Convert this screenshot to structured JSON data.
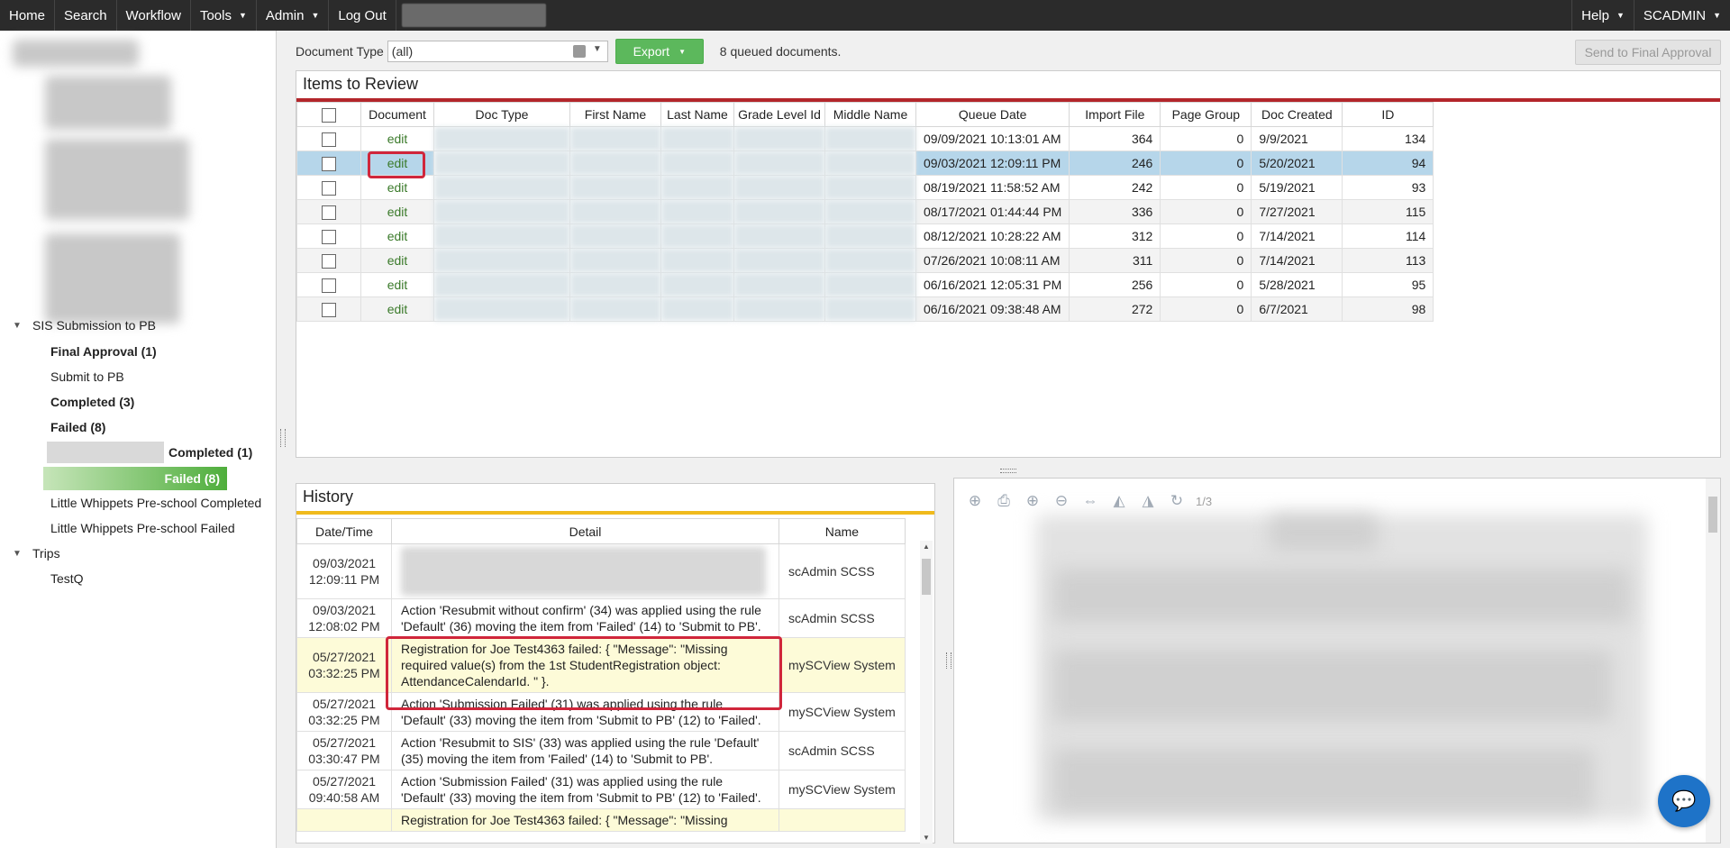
{
  "nav": {
    "items": [
      "Home",
      "Search",
      "Workflow",
      "Tools",
      "Admin",
      "Log Out"
    ],
    "help": "Help",
    "user": "SCADMIN"
  },
  "sidebar": {
    "group1": "SIS Submission to PB",
    "items": [
      "Final Approval (1)",
      "Submit to PB",
      "Completed (3)",
      "Failed (8)"
    ],
    "sub_completed": "Completed (1)",
    "sub_failed": "Failed (8)",
    "pre_completed": "Little Whippets Pre-school Completed",
    "pre_failed": "Little Whippets Pre-school Failed",
    "group2": "Trips",
    "trip_item": "TestQ"
  },
  "toolbar": {
    "doc_type_label": "Document Type",
    "doc_type_value": "(all)",
    "export_label": "Export",
    "queued_text": "8 queued documents.",
    "send_final_label": "Send to Final Approval"
  },
  "review": {
    "title": "Items to Review",
    "columns": [
      "Document",
      "Doc Type",
      "First Name",
      "Last Name",
      "Grade Level Id",
      "Middle Name",
      "Queue Date",
      "Import File",
      "Page Group",
      "Doc Created",
      "ID"
    ],
    "edit_label": "edit",
    "rows": [
      {
        "queue_date": "09/09/2021 10:13:01 AM",
        "import_file": "364",
        "page_group": "0",
        "doc_created": "9/9/2021",
        "id": "134"
      },
      {
        "queue_date": "09/03/2021 12:09:11 PM",
        "import_file": "246",
        "page_group": "0",
        "doc_created": "5/20/2021",
        "id": "94"
      },
      {
        "queue_date": "08/19/2021 11:58:52 AM",
        "import_file": "242",
        "page_group": "0",
        "doc_created": "5/19/2021",
        "id": "93"
      },
      {
        "queue_date": "08/17/2021 01:44:44 PM",
        "import_file": "336",
        "page_group": "0",
        "doc_created": "7/27/2021",
        "id": "115"
      },
      {
        "queue_date": "08/12/2021 10:28:22 AM",
        "import_file": "312",
        "page_group": "0",
        "doc_created": "7/14/2021",
        "id": "114"
      },
      {
        "queue_date": "07/26/2021 10:08:11 AM",
        "import_file": "311",
        "page_group": "0",
        "doc_created": "7/14/2021",
        "id": "113"
      },
      {
        "queue_date": "06/16/2021 12:05:31 PM",
        "import_file": "256",
        "page_group": "0",
        "doc_created": "5/28/2021",
        "id": "95"
      },
      {
        "queue_date": "06/16/2021 09:38:48 AM",
        "import_file": "272",
        "page_group": "0",
        "doc_created": "6/7/2021",
        "id": "98"
      }
    ]
  },
  "history": {
    "title": "History",
    "columns": [
      "Date/Time",
      "Detail",
      "Name"
    ],
    "rows": [
      {
        "date": "09/03/2021",
        "time": "12:09:11 PM",
        "detail": "",
        "name": "scAdmin SCSS"
      },
      {
        "date": "09/03/2021",
        "time": "12:08:02 PM",
        "detail": "Action 'Resubmit without confirm' (34) was applied using the rule 'Default' (36) moving the item from 'Failed' (14) to 'Submit to PB'.",
        "name": "scAdmin SCSS"
      },
      {
        "date": "05/27/2021",
        "time": "03:32:25 PM",
        "detail": "Registration for Joe Test4363 failed: { \"Message\": \"Missing required value(s) from the 1st StudentRegistration object: AttendanceCalendarId. \" }.",
        "name": "mySCView System"
      },
      {
        "date": "05/27/2021",
        "time": "03:32:25 PM",
        "detail": "Action 'Submission Failed' (31) was applied using the rule 'Default' (33) moving the item from 'Submit to PB' (12) to 'Failed'.",
        "name": "mySCView System"
      },
      {
        "date": "05/27/2021",
        "time": "03:30:47 PM",
        "detail": "Action 'Resubmit to SIS' (33) was applied using the rule 'Default' (35) moving the item from 'Failed' (14) to 'Submit to PB'.",
        "name": "scAdmin SCSS"
      },
      {
        "date": "05/27/2021",
        "time": "09:40:58 AM",
        "detail": "Action 'Submission Failed' (31) was applied using the rule 'Default' (33) moving the item from 'Submit to PB' (12) to 'Failed'.",
        "name": "mySCView System"
      },
      {
        "date": "",
        "time": "",
        "detail": "Registration for Joe Test4363 failed: { \"Message\": \"Missing",
        "name": ""
      }
    ]
  },
  "viewer": {
    "page_count": "1/3",
    "icons": [
      "add-page-icon",
      "print-icon",
      "zoom-in-icon",
      "zoom-out-icon",
      "fit-width-icon",
      "flip-horizontal-icon",
      "flip-vertical-icon",
      "rotate-icon"
    ]
  },
  "colors": {
    "nav_bg": "#2b2b2b",
    "export_green": "#5cb85c",
    "review_accent": "#b3262b",
    "history_accent": "#f0ba1c",
    "selected_row": "#b6d6ea",
    "highlight_red": "#d0263b",
    "chat_blue": "#1e73c8"
  }
}
